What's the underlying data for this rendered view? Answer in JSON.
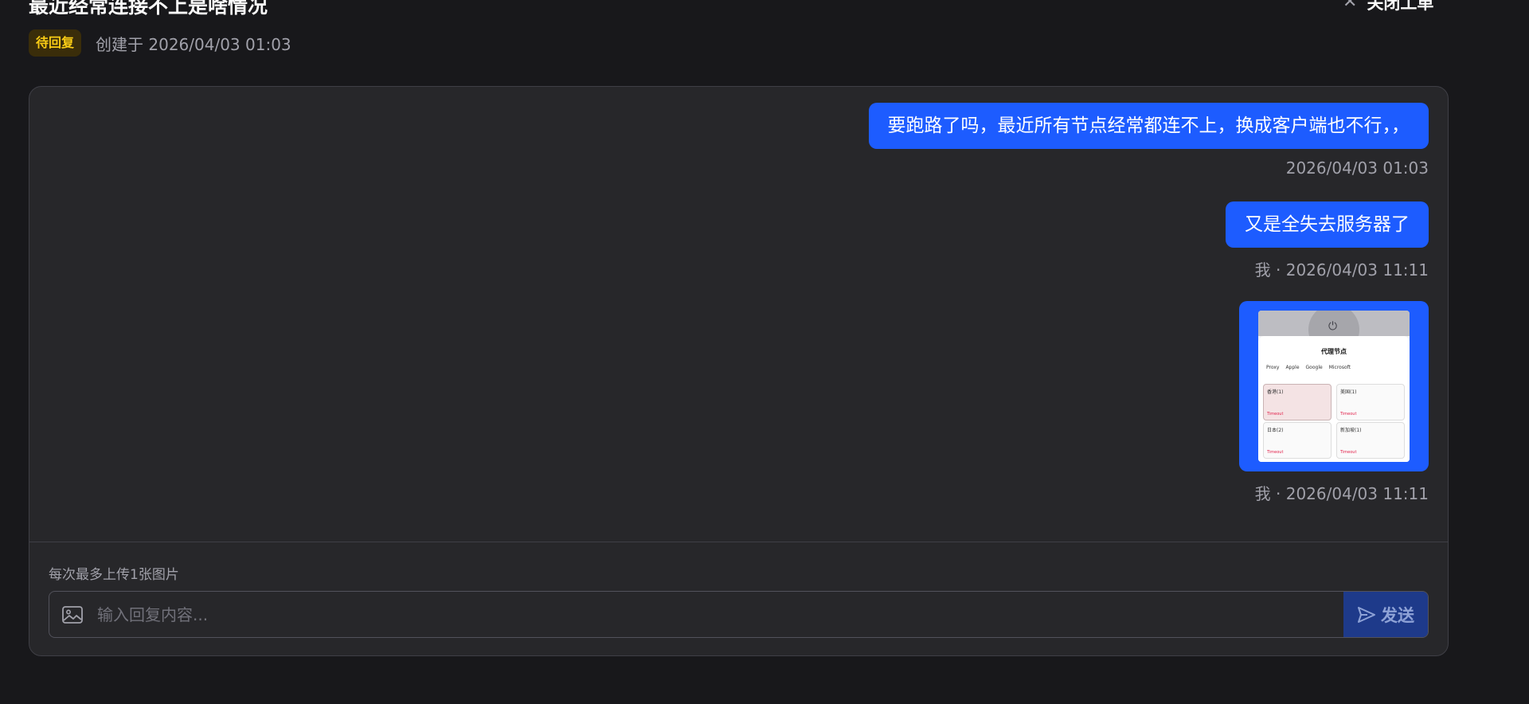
{
  "ticket": {
    "title": "最近经常连接不上是啥情况",
    "close_label": "关闭工单",
    "status_badge": "待回复",
    "created_text": "创建于 2026/04/03 01:03"
  },
  "messages": [
    {
      "text": "要跑路了吗，最近所有节点经常都连不上，换成客户端也不行，，",
      "time": "2026/04/03 01:03"
    },
    {
      "text": "又是全失去服务器了",
      "time": "我 · 2026/04/03 11:11"
    },
    {
      "type": "image",
      "time": "我 · 2026/04/03 11:11"
    }
  ],
  "attachment_screenshot": {
    "title": "代理节点",
    "tabs": [
      "Proxy",
      "Apple",
      "Google",
      "Microsoft"
    ],
    "cards": [
      {
        "name": "香港(1)",
        "status": "Timeout"
      },
      {
        "name": "美国(1)",
        "status": "Timeout"
      },
      {
        "name": "日本(2)",
        "status": "Timeout"
      },
      {
        "name": "新加坡(1)",
        "status": "Timeout"
      }
    ]
  },
  "composer": {
    "hint": "每次最多上传1张图片",
    "placeholder": "输入回复内容...",
    "send_label": "发送"
  },
  "icons": {
    "close": "close-icon",
    "image": "image-icon",
    "send": "send-icon"
  },
  "colors": {
    "background": "#18181b",
    "panel": "#27272a",
    "bubble": "#1d5cff",
    "badge_text": "#facc15",
    "send_button": "#1e3a8a"
  }
}
